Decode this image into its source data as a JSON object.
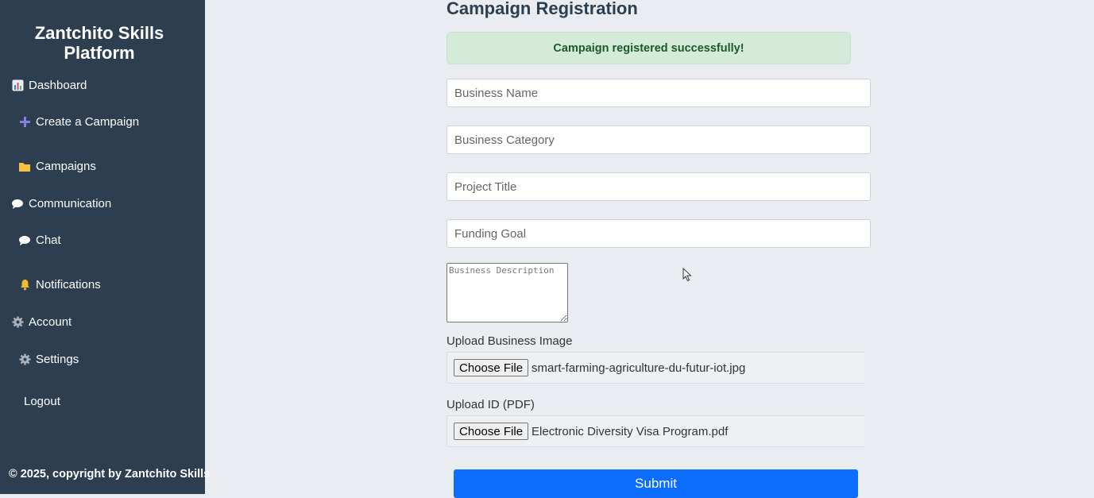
{
  "sidebar": {
    "brand": "Zantchito Skills Platform",
    "items": [
      {
        "label": "Dashboard",
        "icon": "chart-icon"
      },
      {
        "label": "Create a Campaign",
        "icon": "plus-icon"
      },
      {
        "label": "Campaigns",
        "icon": "folder-icon"
      },
      {
        "label": "Communication",
        "icon": "speech-bubble-icon"
      },
      {
        "label": "Chat",
        "icon": "speech-bubble-icon"
      },
      {
        "label": "Notifications",
        "icon": "bell-icon"
      },
      {
        "label": "Account",
        "icon": "gear-icon"
      },
      {
        "label": "Settings",
        "icon": "gear-icon"
      },
      {
        "label": "Logout"
      }
    ],
    "footer": "© 2025, copyright by Zantchito Skills"
  },
  "main": {
    "title": "Campaign Registration",
    "alert": "Campaign registered successfully!",
    "fields": {
      "business_name": {
        "placeholder": "Business Name",
        "value": ""
      },
      "business_category": {
        "placeholder": "Business Category",
        "value": ""
      },
      "project_title": {
        "placeholder": "Project Title",
        "value": ""
      },
      "funding_goal": {
        "placeholder": "Funding Goal",
        "value": ""
      },
      "business_description": {
        "placeholder": "Business Description",
        "value": ""
      }
    },
    "uploads": {
      "image": {
        "label": "Upload Business Image",
        "button": "Choose File",
        "file": "smart-farming-agriculture-du-futur-iot.jpg"
      },
      "id": {
        "label": "Upload ID (PDF)",
        "button": "Choose File",
        "file": "Electronic Diversity Visa Program.pdf"
      }
    },
    "submit_label": "Submit"
  },
  "colors": {
    "sidebar_bg": "#2c3e50",
    "page_bg": "#e9edf1",
    "alert_bg": "#d4ebda",
    "alert_text": "#1a5a2a",
    "primary": "#0d6efd"
  }
}
